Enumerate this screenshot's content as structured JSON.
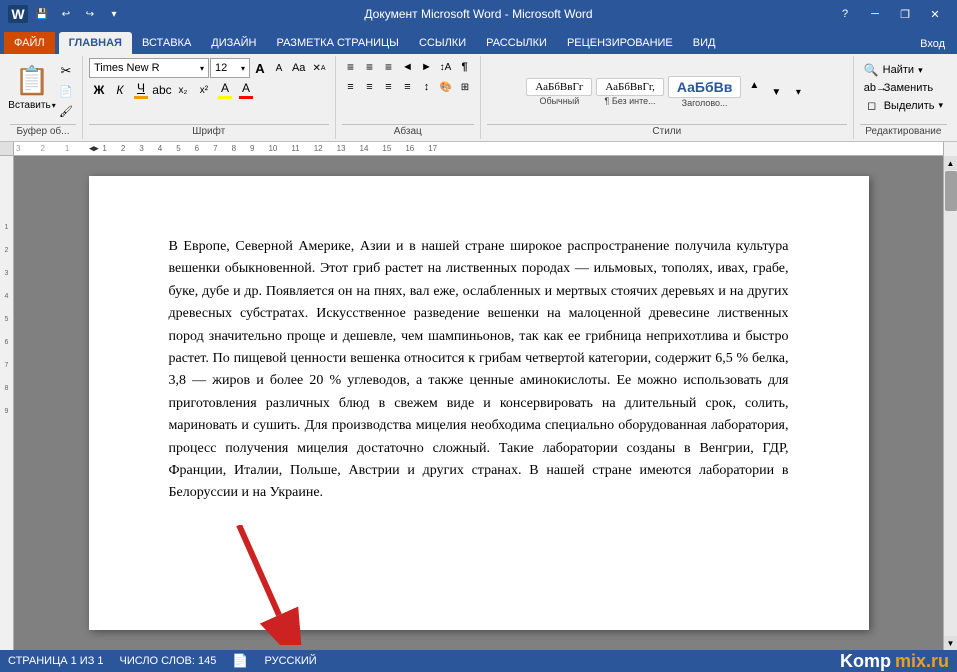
{
  "titlebar": {
    "title": "Документ Microsoft Word - Microsoft Word",
    "help": "?",
    "minimize": "─",
    "restore": "❐",
    "close": "✕"
  },
  "quickaccess": {
    "save": "💾",
    "undo": "↩",
    "redo": "↪",
    "customize": "▼"
  },
  "tabs": [
    {
      "id": "file",
      "label": "ФАЙЛ"
    },
    {
      "id": "home",
      "label": "ГЛАВНАЯ",
      "active": true
    },
    {
      "id": "insert",
      "label": "ВСТАВКА"
    },
    {
      "id": "design",
      "label": "ДИЗАЙН"
    },
    {
      "id": "layout",
      "label": "РАЗМЕТКА СТРАНИЦЫ"
    },
    {
      "id": "references",
      "label": "ССЫЛКИ"
    },
    {
      "id": "mailings",
      "label": "РАССЫЛКИ"
    },
    {
      "id": "review",
      "label": "РЕЦЕНЗИРОВАНИЕ"
    },
    {
      "id": "view",
      "label": "ВИД"
    }
  ],
  "ribbon": {
    "clipboard": {
      "label": "Буфер об...",
      "paste_label": "Вставить"
    },
    "font": {
      "label": "Шрифт",
      "name": "Times New R",
      "size": "12",
      "bold": "Ж",
      "italic": "К",
      "underline": "Ч",
      "strikethrough": "abc",
      "subscript": "х₂",
      "superscript": "х²",
      "grow": "A",
      "shrink": "A",
      "case": "Aa",
      "clear": "✕",
      "highlight_label": "А",
      "font_color_label": "А"
    },
    "paragraph": {
      "label": "Абзац"
    },
    "styles": {
      "label": "Стили",
      "items": [
        {
          "label": "АаБбВвГг",
          "sub": "Обычный"
        },
        {
          "label": "АаБбВвГг,",
          "sub": "¶ Без инте..."
        },
        {
          "label": "АаБбВв",
          "sub": "Заголово..."
        }
      ]
    },
    "editing": {
      "label": "Редактирование",
      "find": "Найти",
      "replace": "Заменить",
      "select": "Выделить"
    }
  },
  "document": {
    "text": "В Европе, Северной Америке, Азии и в нашей стране широкое распространение получила культура вешенки обыкновенной. Этот гриб растет на лиственных породах — ильмовых, тополях, ивах, грабе, буке, дубе и др. Появляется он на пнях, вал еже, ослабленных и мертвых стоячих деревьях и на других древесных субстратах. Искусственное разведение вешенки на малоценной древесине лиственных пород значительно проще и дешевле, чем шампиньонов, так как ее грибница неприхотлива и быстро растет. По пищевой ценности вешенка относится к грибам четвертой категории, содержит 6,5 % белка, 3,8 — жиров и более 20 % углеводов, а также ценные аминокислоты. Ее можно использовать для приготовления различных блюд в свежем виде и консервировать на длительный срок, солить, мариновать и сушить. Для производства мицелия необходима специально оборудованная лаборатория, процесс получения мицелия достаточно сложный. Такие лаборатории созданы в Венгрии, ГДР, Франции, Италии, Польше, Австрии и других странах. В нашей стране имеются лаборатории в Белоруссии и на Украине."
  },
  "statusbar": {
    "page": "СТРАНИЦА 1 ИЗ 1",
    "words": "ЧИСЛО СЛОВ: 145",
    "language": "РУССКИЙ",
    "signin": "Вход"
  },
  "watermark": {
    "prefix": "Komp",
    "suffix": "mix.ru"
  }
}
